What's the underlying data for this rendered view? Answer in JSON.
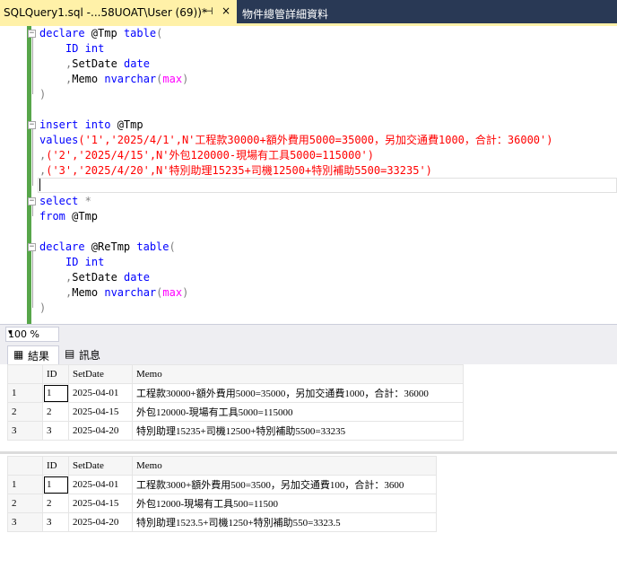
{
  "tabs": {
    "active_title": "SQLQuery1.sql -...58UOAT\\User (69))*",
    "pin_icon": "⊣",
    "close_icon": "×",
    "inactive_title": "物件總管詳細資料"
  },
  "editor": {
    "l1_kw": "declare",
    "l1_var": " @Tmp ",
    "l1_kw2": "table",
    "l1_p": "(",
    "l2_kw": "ID int",
    "l3_p": ",",
    "l3_t": "SetDate ",
    "l3_kw": "date",
    "l4_p": ",",
    "l4_t": "Memo ",
    "l4_kw": "nvarchar",
    "l4_p2": "(",
    "l4_fn": "max",
    "l4_p3": ")",
    "l5_p": ")",
    "l7_kw": "insert into",
    "l7_t": " @Tmp",
    "l8_kw": "values",
    "l8_s": "('1','2025/4/1',N'工程款30000+額外費用5000=35000，另加交通費1000，合計：36000')",
    "l9_p": ",",
    "l9_s": "('2','2025/4/15',N'外包120000-現場有工具5000=115000')",
    "l10_p": ",",
    "l10_s": "('3','2025/4/20',N'特別助理15235+司機12500+特別補助5500=33235')",
    "l12_kw": "select",
    "l12_p": " *",
    "l13_kw": "from",
    "l13_t": " @Tmp",
    "l15_kw": "declare",
    "l15_var": " @ReTmp ",
    "l15_kw2": "table",
    "l15_p": "(",
    "l16_kw": "ID int",
    "l17_p": ",",
    "l17_t": "SetDate ",
    "l17_kw": "date",
    "l18_p": ",",
    "l18_t": "Memo ",
    "l18_kw": "nvarchar",
    "l18_p2": "(",
    "l18_fn": "max",
    "l18_p3": ")",
    "l19_p": ")"
  },
  "zoom": {
    "value": "100 %",
    "dropdown_icon": "▾"
  },
  "result_tabs": {
    "results_label": "結果",
    "results_icon": "▦",
    "messages_label": "訊息",
    "messages_icon": "▤"
  },
  "grid1": {
    "headers": [
      "ID",
      "SetDate",
      "Memo"
    ],
    "rows": [
      {
        "num": "1",
        "id": "1",
        "date": "2025-04-01",
        "memo": "工程款30000+額外費用5000=35000，另加交通費1000，合計：36000"
      },
      {
        "num": "2",
        "id": "2",
        "date": "2025-04-15",
        "memo": "外包120000-現場有工具5000=115000"
      },
      {
        "num": "3",
        "id": "3",
        "date": "2025-04-20",
        "memo": "特別助理15235+司機12500+特別補助5500=33235"
      }
    ]
  },
  "grid2": {
    "headers": [
      "ID",
      "SetDate",
      "Memo"
    ],
    "rows": [
      {
        "num": "1",
        "id": "1",
        "date": "2025-04-01",
        "memo": "工程款3000+額外費用500=3500，另加交通費100，合計：3600"
      },
      {
        "num": "2",
        "id": "2",
        "date": "2025-04-15",
        "memo": "外包12000-現場有工具500=11500"
      },
      {
        "num": "3",
        "id": "3",
        "date": "2025-04-20",
        "memo": "特別助理1523.5+司機1250+特別補助550=3323.5"
      }
    ]
  }
}
